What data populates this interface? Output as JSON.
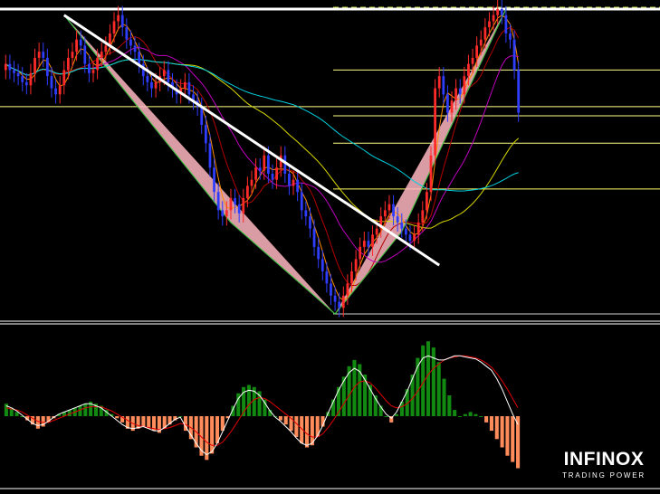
{
  "brand": {
    "name": "INFINOX",
    "tagline": "TRADING POWER"
  },
  "colors": {
    "background": "#000000",
    "bull_candle": "#ff2a2a",
    "bear_candle": "#2f3dff",
    "pattern_fill": "#ffb6c1",
    "trend_line": "#ffffff",
    "ma_fast": "#ff8c00",
    "ma_mid": "#b40000",
    "ma_slow": "#c000c0",
    "ma_long": "#d8d800",
    "ma_longest": "#00d0e0",
    "zigzag": "#2ecc40",
    "macd_pos": "#128a12",
    "macd_neg": "#ff8c5a",
    "macd_line": "#ffffff",
    "signal_line": "#e00000"
  },
  "chart_data": {
    "type": "candlestick",
    "panels": [
      "price",
      "macd"
    ],
    "xlabel": "",
    "ylabel": "",
    "grid": false,
    "legend": "none",
    "price": {
      "ylim": [
        0,
        100
      ],
      "harmonic_pattern": {
        "type": "bearish-bat-like",
        "points": [
          [
            14,
            98
          ],
          [
            54,
            30
          ],
          [
            79,
            0
          ],
          [
            95,
            27
          ],
          [
            120,
            100
          ]
        ]
      },
      "trend_line": {
        "from": [
          14,
          98
        ],
        "to": [
          104,
          16
        ]
      },
      "levels": [
        100,
        80,
        68,
        65,
        56,
        41,
        0
      ],
      "closes": [
        82,
        80,
        79,
        78,
        76,
        75,
        79,
        84,
        86,
        84,
        78,
        74,
        72,
        75,
        80,
        84,
        86,
        90,
        88,
        82,
        79,
        80,
        84,
        86,
        88,
        92,
        96,
        98,
        94,
        90,
        88,
        86,
        82,
        78,
        76,
        74,
        76,
        78,
        80,
        76,
        74,
        72,
        74,
        76,
        72,
        70,
        68,
        62,
        56,
        48,
        40,
        34,
        32,
        34,
        38,
        36,
        33,
        38,
        42,
        44,
        48,
        47,
        52,
        46,
        44,
        48,
        52,
        46,
        42,
        44,
        40,
        34,
        32,
        28,
        22,
        18,
        14,
        10,
        6,
        4,
        2,
        6,
        10,
        14,
        18,
        22,
        24,
        22,
        26,
        28,
        32,
        34,
        36,
        32,
        30,
        28,
        26,
        24,
        26,
        30,
        34,
        40,
        52,
        74,
        78,
        72,
        66,
        70,
        74,
        72,
        78,
        82,
        84,
        88,
        90,
        94,
        96,
        98,
        100,
        98,
        92,
        90,
        80,
        66
      ]
    },
    "macd": {
      "ylim": [
        -60,
        80
      ],
      "histogram": [
        12,
        8,
        4,
        0,
        -4,
        -8,
        -12,
        -10,
        -6,
        -2,
        2,
        4,
        6,
        8,
        10,
        12,
        14,
        12,
        10,
        6,
        2,
        -2,
        -6,
        -12,
        -14,
        -12,
        -10,
        -12,
        -14,
        -16,
        -12,
        -8,
        -4,
        0,
        -14,
        -22,
        -30,
        -38,
        -42,
        -36,
        -26,
        -14,
        -2,
        10,
        22,
        28,
        30,
        28,
        24,
        16,
        6,
        0,
        -4,
        -8,
        -14,
        -20,
        -26,
        -30,
        -28,
        -20,
        -10,
        4,
        16,
        28,
        38,
        48,
        54,
        50,
        40,
        30,
        20,
        10,
        0,
        -6,
        2,
        14,
        26,
        40,
        56,
        68,
        72,
        66,
        52,
        36,
        20,
        6,
        0,
        2,
        4,
        2,
        0,
        -6,
        -14,
        -22,
        -30,
        -38,
        -44,
        -50
      ],
      "macd_line": [
        10,
        8,
        5,
        1,
        -3,
        -7,
        -9,
        -8,
        -5,
        -1,
        2,
        4,
        6,
        8,
        10,
        12,
        12,
        10,
        8,
        4,
        0,
        -4,
        -8,
        -11,
        -12,
        -11,
        -10,
        -12,
        -14,
        -14,
        -11,
        -7,
        -3,
        -1,
        -10,
        -18,
        -26,
        -33,
        -37,
        -34,
        -26,
        -15,
        -4,
        7,
        17,
        23,
        25,
        24,
        20,
        13,
        5,
        -1,
        -5,
        -10,
        -15,
        -21,
        -26,
        -28,
        -26,
        -19,
        -9,
        3,
        14,
        25,
        34,
        42,
        46,
        43,
        35,
        26,
        17,
        9,
        2,
        -2,
        4,
        14,
        24,
        36,
        48,
        56,
        58,
        56,
        54,
        54,
        56,
        58,
        58,
        57,
        56,
        55,
        52,
        48,
        44,
        36,
        26,
        14,
        2,
        -8
      ],
      "signal_line": [
        8,
        7,
        6,
        4,
        1,
        -2,
        -5,
        -6,
        -6,
        -4,
        -2,
        0,
        2,
        4,
        6,
        8,
        9,
        9,
        9,
        7,
        5,
        2,
        -1,
        -4,
        -7,
        -9,
        -10,
        -11,
        -12,
        -13,
        -12,
        -11,
        -9,
        -7,
        -8,
        -11,
        -15,
        -20,
        -25,
        -28,
        -28,
        -25,
        -19,
        -12,
        -4,
        4,
        11,
        16,
        18,
        17,
        14,
        10,
        6,
        2,
        -2,
        -7,
        -12,
        -17,
        -20,
        -20,
        -17,
        -11,
        -4,
        4,
        12,
        20,
        28,
        33,
        34,
        32,
        27,
        21,
        15,
        10,
        8,
        9,
        12,
        17,
        24,
        32,
        40,
        46,
        50,
        54,
        56,
        57,
        58,
        58,
        57,
        56,
        54,
        51,
        47,
        41,
        34,
        26,
        17,
        8
      ]
    }
  }
}
